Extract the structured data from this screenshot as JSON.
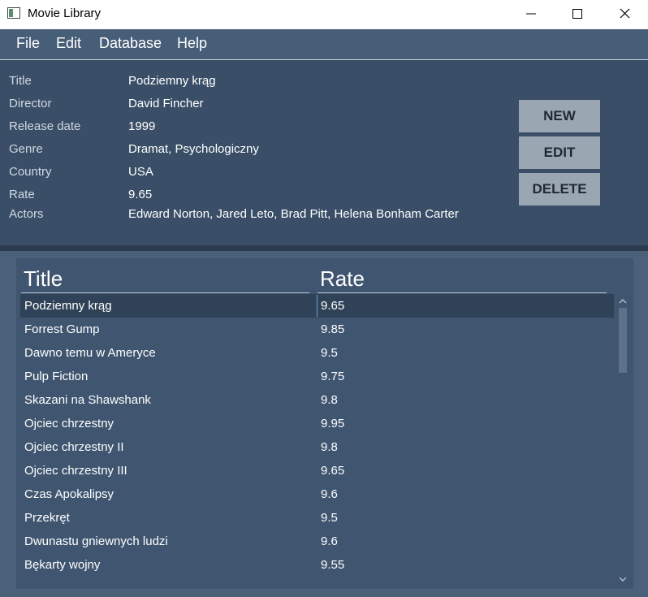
{
  "window": {
    "title": "Movie Library",
    "app_icon": "app-icon",
    "controls": [
      "minimize-icon",
      "maximize-icon",
      "close-icon"
    ]
  },
  "menu": [
    "File",
    "Edit",
    "Database",
    "Help"
  ],
  "details": {
    "fields": [
      {
        "label": "Title",
        "value": "Podziemny krąg"
      },
      {
        "label": "Director",
        "value": "David Fincher"
      },
      {
        "label": "Release date",
        "value": "1999"
      },
      {
        "label": "Genre",
        "value": "Dramat, Psychologiczny"
      },
      {
        "label": "Country",
        "value": "USA"
      },
      {
        "label": "Rate",
        "value": "9.65"
      },
      {
        "label": "Actors",
        "value": "Edward Norton, Jared Leto, Brad Pitt, Helena Bonham Carter"
      }
    ]
  },
  "actions": {
    "new": "NEW",
    "edit": "EDIT",
    "delete": "DELETE"
  },
  "table": {
    "columns": [
      "Title",
      "Rate"
    ],
    "rows": [
      {
        "title": "Podziemny krąg",
        "rate": "9.65"
      },
      {
        "title": "Forrest Gump",
        "rate": "9.85"
      },
      {
        "title": "Dawno temu w Ameryce",
        "rate": "9.5"
      },
      {
        "title": "Pulp Fiction",
        "rate": "9.75"
      },
      {
        "title": "Skazani na Shawshank",
        "rate": "9.8"
      },
      {
        "title": "Ojciec chrzestny",
        "rate": "9.95"
      },
      {
        "title": "Ojciec chrzestny II",
        "rate": "9.8"
      },
      {
        "title": "Ojciec chrzestny III",
        "rate": "9.65"
      },
      {
        "title": "Czas Apokalipsy",
        "rate": "9.6"
      },
      {
        "title": "Przekręt",
        "rate": "9.5"
      },
      {
        "title": "Dwunastu gniewnych ludzi",
        "rate": "9.6"
      },
      {
        "title": "Bękarty wojny",
        "rate": "9.55"
      }
    ],
    "selected_index": 0
  },
  "colors": {
    "window_bg": "#3e536b",
    "menubar": "#475e78",
    "details_bg": "#3a4f67",
    "button_bg": "#9aa6b2",
    "selected_row": "#2f4258",
    "selection_accent": "#6fa3d6"
  }
}
